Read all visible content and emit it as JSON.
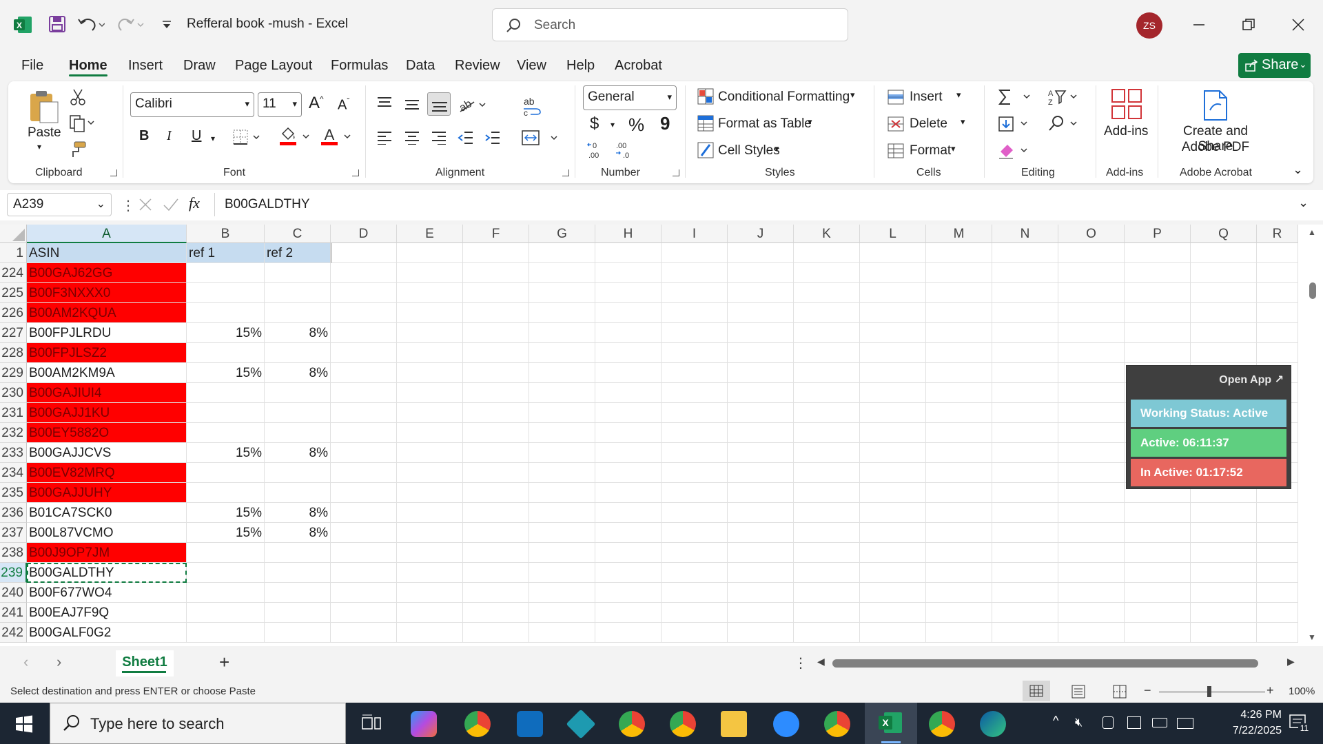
{
  "titlebar": {
    "doc_title": "Refferal book -mush  -  Excel",
    "search_placeholder": "Search",
    "user_initials": "ZS"
  },
  "tabs": [
    "File",
    "Home",
    "Insert",
    "Draw",
    "Page Layout",
    "Formulas",
    "Data",
    "Review",
    "View",
    "Help",
    "Acrobat"
  ],
  "active_tab": "Home",
  "share_label": "Share",
  "ribbon": {
    "clipboard": {
      "paste": "Paste",
      "label": "Clipboard"
    },
    "font": {
      "name": "Calibri",
      "size": "11",
      "bold": "B",
      "italic": "I",
      "underline": "U",
      "label": "Font"
    },
    "alignment": {
      "label": "Alignment"
    },
    "number": {
      "format": "General",
      "currency": "$",
      "percent": "%",
      "comma": "9",
      "label": "Number"
    },
    "styles": {
      "conditional": "Conditional Formatting",
      "format_table": "Format as Table",
      "cell_styles": "Cell Styles",
      "label": "Styles"
    },
    "cells": {
      "insert": "Insert",
      "delete": "Delete",
      "format": "Format",
      "label": "Cells"
    },
    "editing": {
      "label": "Editing"
    },
    "addins": {
      "button": "Add-ins",
      "label": "Add-ins"
    },
    "acrobat": {
      "line1": "Create and Share",
      "line2": "Adobe PDF",
      "label": "Adobe Acrobat"
    }
  },
  "formula_bar": {
    "name_box": "A239",
    "fx": "fx",
    "content": "B00GALDTHY"
  },
  "grid": {
    "columns": [
      "A",
      "B",
      "C",
      "D",
      "E",
      "F",
      "G",
      "H",
      "I",
      "J",
      "K",
      "L",
      "M",
      "N",
      "O",
      "P",
      "Q",
      "R"
    ],
    "header_row": {
      "num": "1",
      "a": "ASIN",
      "b": "ref 1",
      "c": "ref 2"
    },
    "rows": [
      {
        "num": "224",
        "a": "B00GAJ62GG",
        "b": "",
        "c": "",
        "red": true
      },
      {
        "num": "225",
        "a": "B00F3NXXX0",
        "b": "",
        "c": "",
        "red": true
      },
      {
        "num": "226",
        "a": "B00AM2KQUA",
        "b": "",
        "c": "",
        "red": true
      },
      {
        "num": "227",
        "a": "B00FPJLRDU",
        "b": "15%",
        "c": "8%",
        "red": false
      },
      {
        "num": "228",
        "a": "B00FPJLSZ2",
        "b": "",
        "c": "",
        "red": true
      },
      {
        "num": "229",
        "a": "B00AM2KM9A",
        "b": "15%",
        "c": "8%",
        "red": false
      },
      {
        "num": "230",
        "a": "B00GAJIUI4",
        "b": "",
        "c": "",
        "red": true
      },
      {
        "num": "231",
        "a": "B00GAJJ1KU",
        "b": "",
        "c": "",
        "red": true
      },
      {
        "num": "232",
        "a": "B00EY5882O",
        "b": "",
        "c": "",
        "red": true
      },
      {
        "num": "233",
        "a": "B00GAJJCVS",
        "b": "15%",
        "c": "8%",
        "red": false
      },
      {
        "num": "234",
        "a": "B00EV82MRQ",
        "b": "",
        "c": "",
        "red": true
      },
      {
        "num": "235",
        "a": "B00GAJJUHY",
        "b": "",
        "c": "",
        "red": true
      },
      {
        "num": "236",
        "a": "B01CA7SCK0",
        "b": "15%",
        "c": "8%",
        "red": false
      },
      {
        "num": "237",
        "a": "B00L87VCMO",
        "b": "15%",
        "c": "8%",
        "red": false
      },
      {
        "num": "238",
        "a": "B00J9OP7JM",
        "b": "",
        "c": "",
        "red": true
      },
      {
        "num": "239",
        "a": "B00GALDTHY",
        "b": "",
        "c": "",
        "red": false
      },
      {
        "num": "240",
        "a": "B00F677WO4",
        "b": "",
        "c": "",
        "red": false
      },
      {
        "num": "241",
        "a": "B00EAJ7F9Q",
        "b": "",
        "c": "",
        "red": false
      },
      {
        "num": "242",
        "a": "B00GALF0G2",
        "b": "",
        "c": "",
        "red": false
      }
    ],
    "active_row": "239"
  },
  "widget": {
    "open_app": "Open App ↗",
    "status": "Working Status: Active",
    "active": "Active: 06:11:37",
    "inactive": "In Active: 01:17:52",
    "colors": {
      "status": "#7ec8d4",
      "active": "#5fcf80",
      "inactive": "#e8675f"
    }
  },
  "sheet_tab": "Sheet1",
  "status_bar": {
    "message": "Select destination and press ENTER or choose Paste",
    "zoom": "100%"
  },
  "taskbar": {
    "search_placeholder": "Type here to search",
    "time": "4:26 PM",
    "date": "7/22/2025",
    "notifications": "11"
  },
  "colors": {
    "excel_green": "#107c41",
    "error_red": "#ff0000"
  }
}
